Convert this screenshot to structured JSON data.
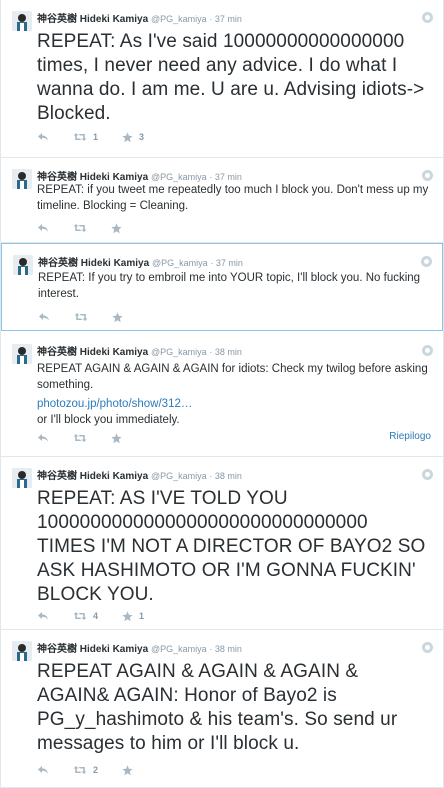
{
  "author": {
    "fullname": "神谷英樹 Hideki Kamiya",
    "handle": "@PG_kamiya"
  },
  "tweets": [
    {
      "time": "37 min",
      "text": "REPEAT: As I've said 10000000000000000 times, I never need any advice. I do what I wanna do. I am me. U are u. Advising idiots-> Blocked.",
      "retweets": "1",
      "favorites": "3"
    },
    {
      "time": "37 min",
      "text": "REPEAT: if you tweet me repeatedly too much I block you. Don't mess up my timeline. Blocking = Cleaning.",
      "retweets": "",
      "favorites": ""
    },
    {
      "time": "37 min",
      "text": "REPEAT: If you try to embroil me into YOUR topic, I'll block you. No fucking interest.",
      "retweets": "",
      "favorites": ""
    },
    {
      "time": "38 min",
      "text": "REPEAT AGAIN & AGAIN & AGAIN for idiots: Check my twilog before asking something.",
      "link": "photozou.jp/photo/show/312…",
      "text_after": "or I'll block you immediately.",
      "summary": "Riepilogo",
      "retweets": "",
      "favorites": ""
    },
    {
      "time": "38 min",
      "text": "REPEAT: AS I'VE TOLD YOU 1000000000000000000000000000000 TIMES I'M NOT A DIRECTOR OF BAYO2 SO ASK HASHIMOTO OR I'M GONNA FUCKIN' BLOCK YOU.",
      "retweets": "4",
      "favorites": "1"
    },
    {
      "time": "38 min",
      "text": "REPEAT AGAIN & AGAIN & AGAIN & AGAIN& AGAIN: Honor of Bayo2 is PG_y_hashimoto & his team's. So send ur messages to him or I'll block u.",
      "retweets": "2",
      "favorites": ""
    }
  ],
  "colors": {
    "link": "#2b7bb9",
    "muted": "#8899a6",
    "icon": "#aab8c2",
    "border": "#e1e8ed",
    "focus": "#8ec3e6"
  },
  "icons": [
    "reply-icon",
    "retweet-icon",
    "favorite-icon",
    "gear-icon",
    "avatar"
  ]
}
